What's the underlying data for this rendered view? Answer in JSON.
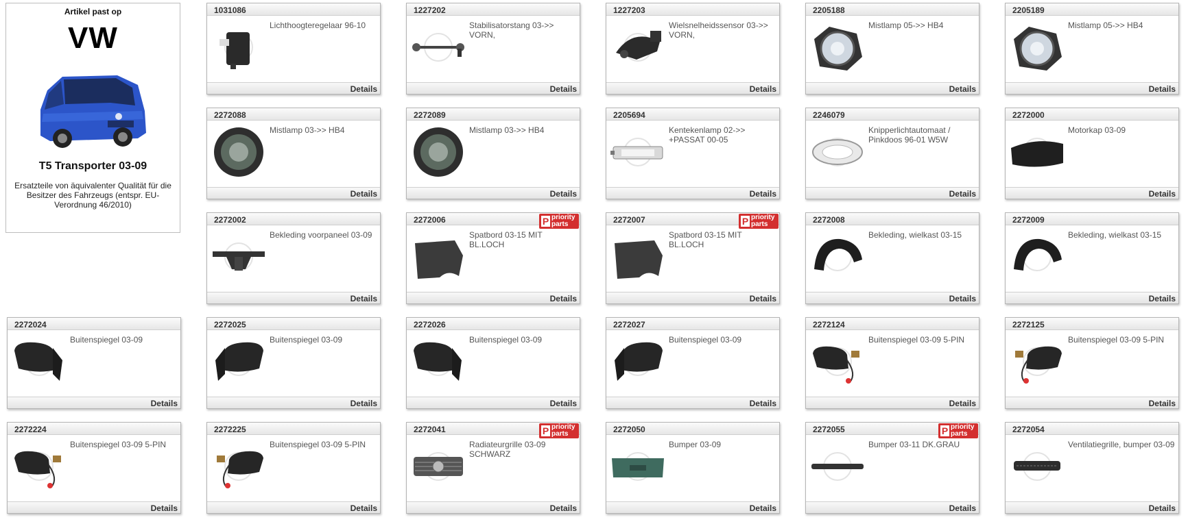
{
  "info": {
    "heading": "Artikel past op",
    "brand": "VW",
    "model": "T5 Transporter 03-09",
    "note": "Ersatzteile von äquivalenter Qualität für die Besitzer des Fahrzeugs (entspr. EU-Verordnung 46/2010)"
  },
  "details_label": "Details",
  "badge": {
    "line1": "priority",
    "line2": "parts"
  },
  "products": [
    {
      "id": "1031086",
      "title": "Lichthoogteregelaar 96-10",
      "icon": "headlight-level-actuator",
      "priority": false
    },
    {
      "id": "1227202",
      "title": "Stabilisatorstang 03->> VORN,",
      "icon": "stabilizer-link",
      "priority": false
    },
    {
      "id": "1227203",
      "title": "Wielsnelheidssensor 03->> VORN,",
      "icon": "wheel-speed-sensor",
      "priority": false
    },
    {
      "id": "2205188",
      "title": "Mistlamp 05->> HB4",
      "icon": "fog-lamp",
      "priority": false
    },
    {
      "id": "2205189",
      "title": "Mistlamp 05->> HB4",
      "icon": "fog-lamp",
      "priority": false
    },
    {
      "id": "2272088",
      "title": "Mistlamp 03->> HB4",
      "icon": "fog-lamp-round",
      "priority": false
    },
    {
      "id": "2272089",
      "title": "Mistlamp 03->> HB4",
      "icon": "fog-lamp-round",
      "priority": false
    },
    {
      "id": "2205694",
      "title": "Kentekenlamp 02->> +PASSAT 00-05",
      "icon": "license-plate-lamp",
      "priority": false
    },
    {
      "id": "2246079",
      "title": "Knipperlichtautomaat / Pinkdoos 96-01 W5W",
      "icon": "side-indicator",
      "priority": false
    },
    {
      "id": "2272000",
      "title": "Motorkap 03-09",
      "icon": "bonnet",
      "priority": false
    },
    {
      "id": "2272002",
      "title": "Bekleding voorpaneel 03-09",
      "icon": "front-panel",
      "priority": false
    },
    {
      "id": "2272006",
      "title": "Spatbord 03-15 MIT BL.LOCH",
      "icon": "fender",
      "priority": true
    },
    {
      "id": "2272007",
      "title": "Spatbord 03-15 MIT BL.LOCH",
      "icon": "fender",
      "priority": true
    },
    {
      "id": "2272008",
      "title": "Bekleding, wielkast 03-15",
      "icon": "wheel-arch-liner",
      "priority": false
    },
    {
      "id": "2272009",
      "title": "Bekleding, wielkast 03-15",
      "icon": "wheel-arch-liner",
      "priority": false
    },
    {
      "id": "2272024",
      "title": "Buitenspiegel 03-09",
      "icon": "mirror-left",
      "priority": false
    },
    {
      "id": "2272025",
      "title": "Buitenspiegel 03-09",
      "icon": "mirror-right",
      "priority": false
    },
    {
      "id": "2272026",
      "title": "Buitenspiegel 03-09",
      "icon": "mirror-left",
      "priority": false
    },
    {
      "id": "2272027",
      "title": "Buitenspiegel 03-09",
      "icon": "mirror-right",
      "priority": false
    },
    {
      "id": "2272124",
      "title": "Buitenspiegel 03-09 5-PIN",
      "icon": "mirror-wired-left",
      "priority": false
    },
    {
      "id": "2272125",
      "title": "Buitenspiegel 03-09 5-PIN",
      "icon": "mirror-wired-right",
      "priority": false
    },
    {
      "id": "2272224",
      "title": "Buitenspiegel 03-09 5-PIN",
      "icon": "mirror-wired-left",
      "priority": false
    },
    {
      "id": "2272225",
      "title": "Buitenspiegel 03-09 5-PIN",
      "icon": "mirror-wired-right",
      "priority": false
    },
    {
      "id": "2272041",
      "title": "Radiateurgrille 03-09 SCHWARZ",
      "icon": "radiator-grille",
      "priority": true
    },
    {
      "id": "2272050",
      "title": "Bumper 03-09",
      "icon": "bumper-front",
      "priority": false
    },
    {
      "id": "2272055",
      "title": "Bumper 03-11 DK.GRAU",
      "icon": "bumper-strip",
      "priority": true
    },
    {
      "id": "2272054",
      "title": "Ventilatiegrille, bumper 03-09",
      "icon": "vent-grille",
      "priority": false
    }
  ]
}
